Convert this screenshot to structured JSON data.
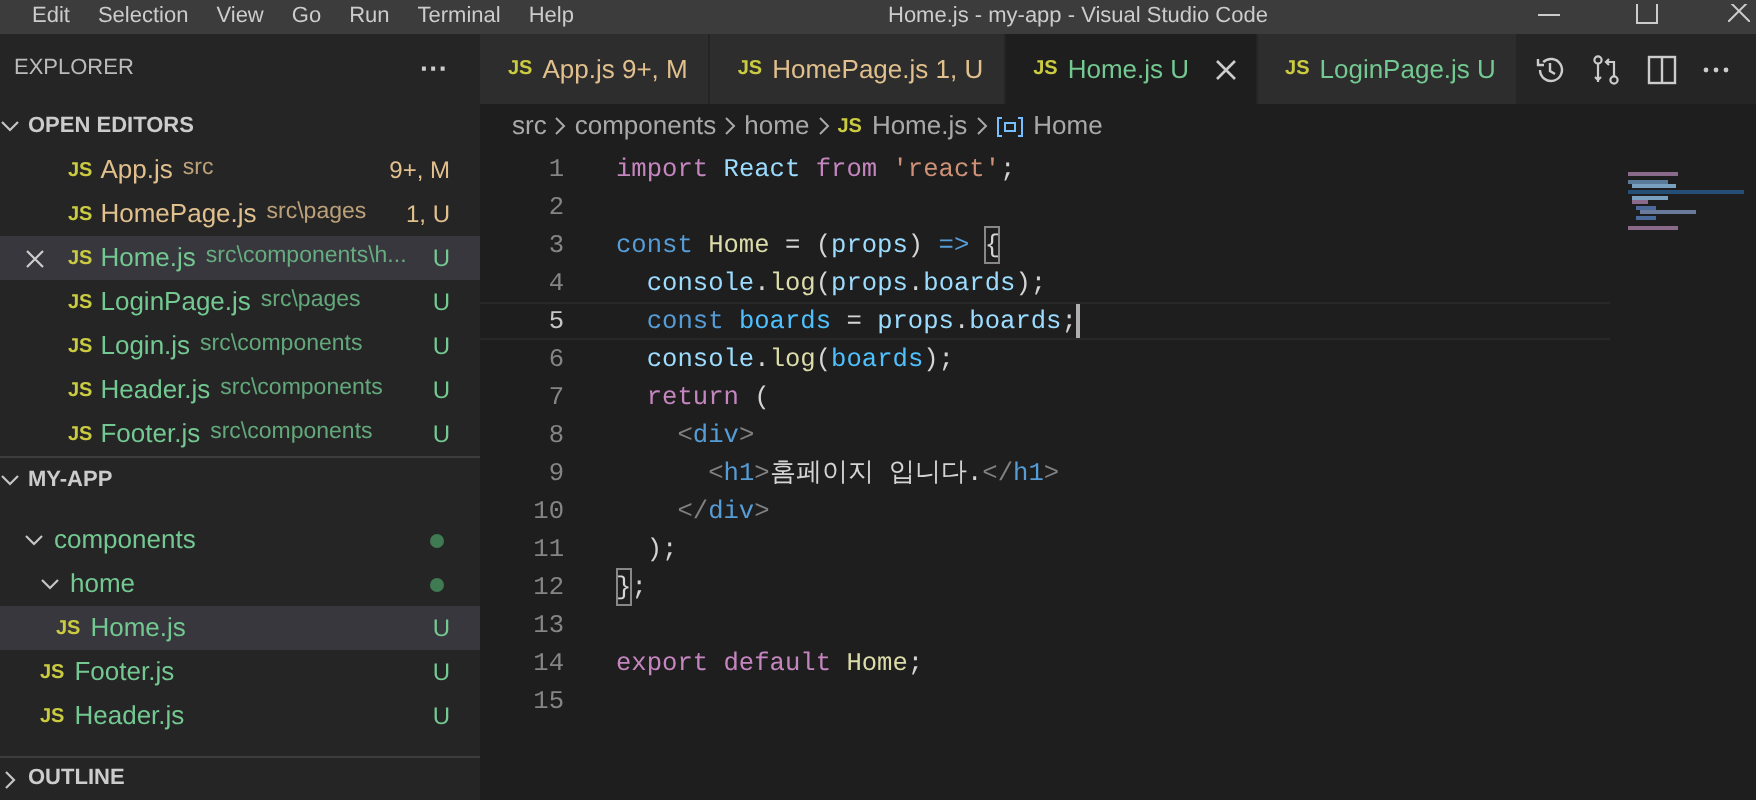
{
  "title_bar": {
    "menu": [
      "Edit",
      "Selection",
      "View",
      "Go",
      "Run",
      "Terminal",
      "Help"
    ],
    "title": "Home.js - my-app - Visual Studio Code"
  },
  "sidebar": {
    "title": "EXPLORER",
    "more": "···",
    "open_editors": {
      "title": "OPEN EDITORS",
      "expanded": true,
      "items": [
        {
          "file_icon": "JS",
          "name": "App.js",
          "path": "src",
          "status": "9+, M",
          "color": "#e2c08d",
          "selected": false
        },
        {
          "file_icon": "JS",
          "name": "HomePage.js",
          "path": "src\\pages",
          "status": "1, U",
          "color": "#e2c08d",
          "selected": false
        },
        {
          "file_icon": "JS",
          "name": "Home.js",
          "path": "src\\components\\h...",
          "status": "U",
          "color": "#73c991",
          "selected": true
        },
        {
          "file_icon": "JS",
          "name": "LoginPage.js",
          "path": "src\\pages",
          "status": "U",
          "color": "#73c991",
          "selected": false
        },
        {
          "file_icon": "JS",
          "name": "Login.js",
          "path": "src\\components",
          "status": "U",
          "color": "#73c991",
          "selected": false
        },
        {
          "file_icon": "JS",
          "name": "Header.js",
          "path": "src\\components",
          "status": "U",
          "color": "#73c991",
          "selected": false
        },
        {
          "file_icon": "JS",
          "name": "Footer.js",
          "path": "src\\components",
          "status": "U",
          "color": "#73c991",
          "selected": false
        }
      ]
    },
    "project": {
      "title": "MY-APP",
      "expanded": true,
      "tree": [
        {
          "kind": "folder",
          "name": "components",
          "expanded": true,
          "selected": false,
          "children": [
            {
              "kind": "folder",
              "name": "home",
              "expanded": true,
              "selected": false,
              "children": [
                {
                  "kind": "file",
                  "file_icon": "JS",
                  "name": "Home.js",
                  "status": "U",
                  "selected": true
                }
              ]
            },
            {
              "kind": "file",
              "file_icon": "JS",
              "name": "Footer.js",
              "status": "U",
              "selected": false
            },
            {
              "kind": "file",
              "file_icon": "JS",
              "name": "Header.js",
              "status": "U",
              "selected": false
            }
          ]
        }
      ]
    },
    "outline": {
      "title": "OUTLINE",
      "expanded": false
    }
  },
  "tabs": [
    {
      "file_icon": "JS",
      "name": "App.js",
      "status": "9+, M",
      "color": "#e2c08d",
      "selected": false
    },
    {
      "file_icon": "JS",
      "name": "HomePage.js",
      "status": "1, U",
      "color": "#e2c08d",
      "selected": false
    },
    {
      "file_icon": "JS",
      "name": "Home.js",
      "status": "U",
      "color": "#73c991",
      "selected": true
    },
    {
      "file_icon": "JS",
      "name": "LoginPage.js",
      "status": "U",
      "color": "#73c991",
      "selected": false
    }
  ],
  "breadcrumb": [
    {
      "kind": "folder",
      "text": "src"
    },
    {
      "kind": "folder",
      "text": "components"
    },
    {
      "kind": "folder",
      "text": "home"
    },
    {
      "kind": "file",
      "file_icon": "JS",
      "text": "Home.js"
    },
    {
      "kind": "symbol",
      "text": "Home"
    }
  ],
  "code": [
    {
      "number": "1",
      "current": false,
      "tokens": [
        {
          "kind": "keyword",
          "text": "import "
        },
        {
          "kind": "variable",
          "text": "React "
        },
        {
          "kind": "keyword",
          "text": "from "
        },
        {
          "kind": "string",
          "text": "'react'"
        },
        {
          "kind": "plain",
          "text": ";"
        }
      ]
    },
    {
      "number": "2",
      "current": false
    },
    {
      "number": "3",
      "current": false,
      "tokens": [
        {
          "kind": "storage",
          "text": "const "
        },
        {
          "kind": "function",
          "text": "Home"
        },
        {
          "kind": "plain",
          "text": " = ("
        },
        {
          "kind": "variable",
          "text": "props"
        },
        {
          "kind": "plain",
          "text": ") "
        },
        {
          "kind": "storage",
          "text": "=> "
        },
        {
          "kind": "bracket",
          "text": "{"
        }
      ]
    },
    {
      "number": "4",
      "current": false,
      "tokens": [
        {
          "kind": "variable",
          "text": "  console"
        },
        {
          "kind": "plain",
          "text": "."
        },
        {
          "kind": "function",
          "text": "log"
        },
        {
          "kind": "plain",
          "text": "("
        },
        {
          "kind": "variable",
          "text": "props"
        },
        {
          "kind": "plain",
          "text": "."
        },
        {
          "kind": "variable",
          "text": "boards"
        },
        {
          "kind": "plain",
          "text": ");"
        }
      ]
    },
    {
      "number": "5",
      "current": true,
      "tokens": [
        {
          "kind": "storage",
          "text": "  const "
        },
        {
          "kind": "constant",
          "text": "boards"
        },
        {
          "kind": "plain",
          "text": " = "
        },
        {
          "kind": "variable",
          "text": "props"
        },
        {
          "kind": "plain",
          "text": "."
        },
        {
          "kind": "variable",
          "text": "boards"
        },
        {
          "kind": "plain",
          "text": ";"
        }
      ]
    },
    {
      "number": "6",
      "current": false,
      "tokens": [
        {
          "kind": "variable",
          "text": "  console"
        },
        {
          "kind": "plain",
          "text": "."
        },
        {
          "kind": "function",
          "text": "log"
        },
        {
          "kind": "plain",
          "text": "("
        },
        {
          "kind": "constant",
          "text": "boards"
        },
        {
          "kind": "plain",
          "text": ");"
        }
      ]
    },
    {
      "number": "7",
      "current": false,
      "tokens": [
        {
          "kind": "keyword",
          "text": "  return"
        },
        {
          "kind": "plain",
          "text": " ("
        }
      ]
    },
    {
      "number": "8",
      "current": false,
      "tokens": [
        {
          "kind": "punct",
          "text": "    <"
        },
        {
          "kind": "storage",
          "text": "div"
        },
        {
          "kind": "punct",
          "text": ">"
        }
      ]
    },
    {
      "number": "9",
      "current": false,
      "tokens": [
        {
          "kind": "punct",
          "text": "      <"
        },
        {
          "kind": "storage",
          "text": "h1"
        },
        {
          "kind": "punct",
          "text": ">"
        },
        {
          "kind": "plain",
          "text": "홈페이지 입니다."
        },
        {
          "kind": "punct",
          "text": "</"
        },
        {
          "kind": "storage",
          "text": "h1"
        },
        {
          "kind": "punct",
          "text": ">"
        }
      ]
    },
    {
      "number": "10",
      "current": false,
      "tokens": [
        {
          "kind": "punct",
          "text": "    </"
        },
        {
          "kind": "storage",
          "text": "div"
        },
        {
          "kind": "punct",
          "text": ">"
        }
      ]
    },
    {
      "number": "11",
      "current": false,
      "tokens": [
        {
          "kind": "plain",
          "text": "  );"
        }
      ]
    },
    {
      "number": "12",
      "current": false,
      "tokens": [
        {
          "kind": "bracket",
          "text": "}"
        },
        {
          "kind": "plain",
          "text": ";"
        }
      ]
    },
    {
      "number": "13",
      "current": false
    },
    {
      "number": "14",
      "current": false,
      "tokens": [
        {
          "kind": "keyword",
          "text": "export default "
        },
        {
          "kind": "function",
          "text": "Home"
        },
        {
          "kind": "plain",
          "text": ";"
        }
      ]
    },
    {
      "number": "15",
      "current": false
    }
  ]
}
